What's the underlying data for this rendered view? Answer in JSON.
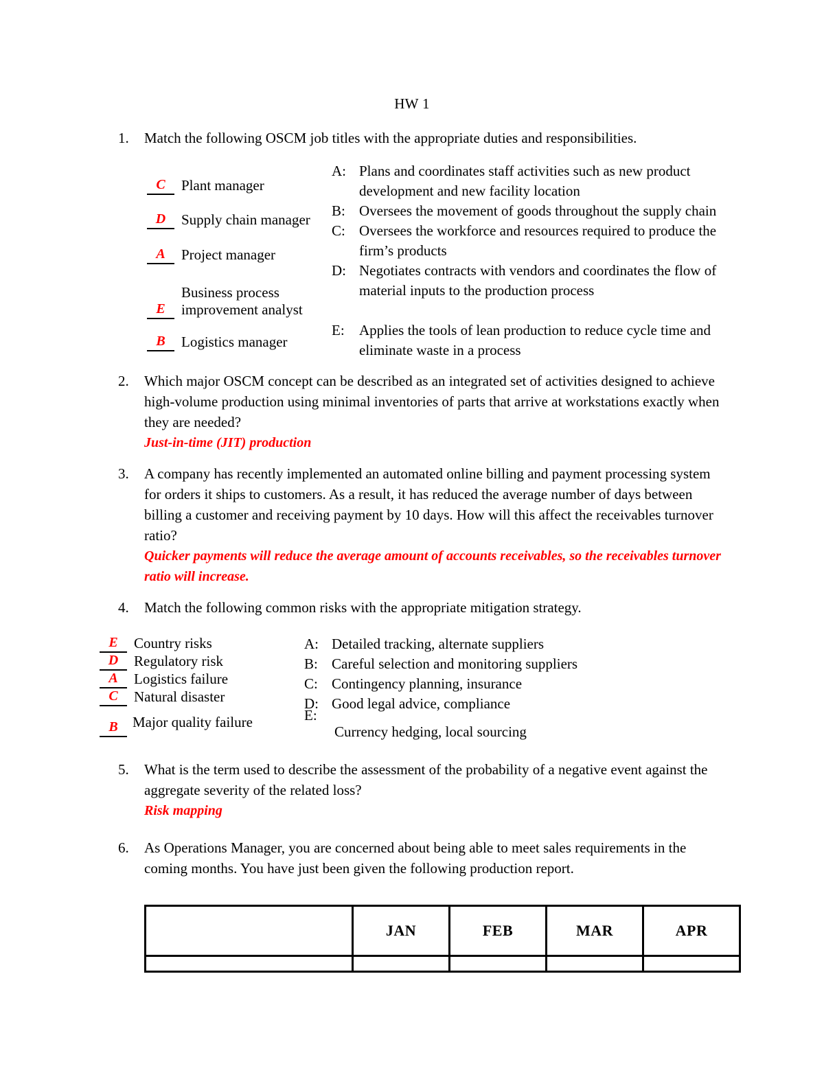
{
  "document": {
    "title": "HW 1",
    "answer_color": "#ff0000"
  },
  "questions": [
    {
      "number": "1.",
      "prompt": "Match the following OSCM job titles with the appropriate duties and responsibilities."
    },
    {
      "number": "2.",
      "prompt": "Which major OSCM concept can be described as an integrated set of activities designed to achieve high-volume production using minimal inventories of parts that arrive at workstations exactly when they are needed?",
      "answer": "Just-in-time (JIT) production"
    },
    {
      "number": "3.",
      "prompt": "A company has recently implemented an automated online billing and payment processing system for orders it ships to customers.  As a result, it has reduced the average number of days between billing a customer and receiving payment by 10 days.  How will this affect the receivables turnover ratio?",
      "answer": "Quicker payments will reduce the average amount of accounts receivables, so the receivables turnover ratio will increase."
    },
    {
      "number": "4.",
      "prompt": "Match the following common risks with the appropriate mitigation strategy."
    },
    {
      "number": "5.",
      "prompt": "What is the term used to describe the assessment of the probability of a negative event against the aggregate severity of the related loss?",
      "answer": "Risk mapping"
    },
    {
      "number": "6.",
      "prompt": "As Operations Manager, you are concerned about being able to meet sales requirements in the coming months.  You have just been given the following production report."
    }
  ],
  "q1_matching": {
    "items": [
      {
        "answer": "C",
        "label": "Plant manager"
      },
      {
        "answer": "D",
        "label": "Supply chain manager"
      },
      {
        "answer": "A",
        "label": "Project manager"
      },
      {
        "answer": "E",
        "label_line1": "Business process",
        "label_line2": "improvement analyst"
      },
      {
        "answer": "B",
        "label": "Logistics manager"
      }
    ],
    "options": [
      {
        "key": "A:",
        "text": "Plans and coordinates staff activities such as new product development and new facility location"
      },
      {
        "key": "B:",
        "text": "Oversees the movement of goods throughout the supply chain"
      },
      {
        "key": "C:",
        "text": "Oversees the workforce and resources required to produce the firm’s products"
      },
      {
        "key": "D:",
        "text": "Negotiates contracts with vendors and coordinates the flow of material inputs to the production process"
      },
      {
        "key": "E:",
        "text": "Applies the tools of lean production to reduce cycle time and eliminate waste in a process"
      }
    ]
  },
  "q4_matching": {
    "items": [
      {
        "answer": "E",
        "label": "Country risks"
      },
      {
        "answer": "D",
        "label": "Regulatory risk"
      },
      {
        "answer": "A",
        "label": "Logistics failure"
      },
      {
        "answer": "C",
        "label": "Natural disaster"
      },
      {
        "answer": "B",
        "label": "Major quality failure"
      }
    ],
    "options": [
      {
        "key": "A:",
        "text": "Detailed tracking, alternate suppliers"
      },
      {
        "key": "B:",
        "text": "Careful selection and monitoring suppliers"
      },
      {
        "key": "C:",
        "text": "Contingency planning, insurance"
      },
      {
        "key": "D:",
        "text": "Good legal advice, compliance"
      },
      {
        "key": "E:",
        "text": "Currency hedging, local sourcing"
      }
    ]
  },
  "production_table": {
    "headers": [
      "",
      "JAN",
      "FEB",
      "MAR",
      "APR"
    ],
    "rows": [
      [
        "",
        "",
        "",
        "",
        ""
      ]
    ]
  }
}
